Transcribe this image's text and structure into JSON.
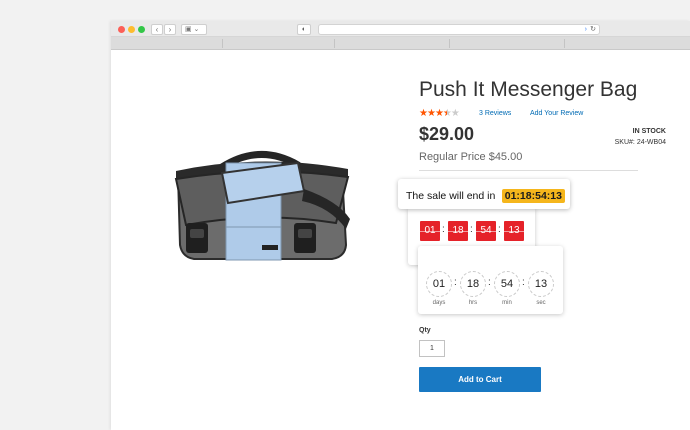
{
  "browser": {
    "back_icon": "chevron-left-icon",
    "forward_icon": "chevron-right-icon",
    "sidebar_icon": "sidebar-icon",
    "privacy_icon": "shield-icon",
    "reload_icon": "reload-icon",
    "url": ""
  },
  "product": {
    "image_alt": "Push It Messenger Bag",
    "name": "Push It Messenger Bag",
    "rating": 3.5,
    "rating_max": 5,
    "reviews_link": "3  Reviews",
    "add_review_link": "Add Your Review",
    "price": "$29.00",
    "regular_price": "Regular Price $45.00",
    "stock_status": "IN STOCK",
    "sku": "SKU#:  24-WB04"
  },
  "sale_banner": {
    "text": "The sale will end in",
    "time": "01:18:54:13"
  },
  "countdown_flip": {
    "values": [
      "01",
      "18",
      "54",
      "13"
    ],
    "units": [
      "days",
      "hrs",
      "min",
      "sec"
    ],
    "separator": ":"
  },
  "countdown_circle": {
    "values": [
      "01",
      "18",
      "54",
      "13"
    ],
    "units": [
      "days",
      "hrs",
      "min",
      "sec"
    ],
    "separator": ":"
  },
  "purchase": {
    "qty_label": "Qty",
    "qty_value": "1",
    "add_to_cart_label": "Add to Cart"
  },
  "colors": {
    "accent": "#1979c3",
    "star": "#ff5501",
    "flip_red": "#e52229",
    "sale_highlight": "#f5b61c",
    "link": "#006bb4"
  }
}
